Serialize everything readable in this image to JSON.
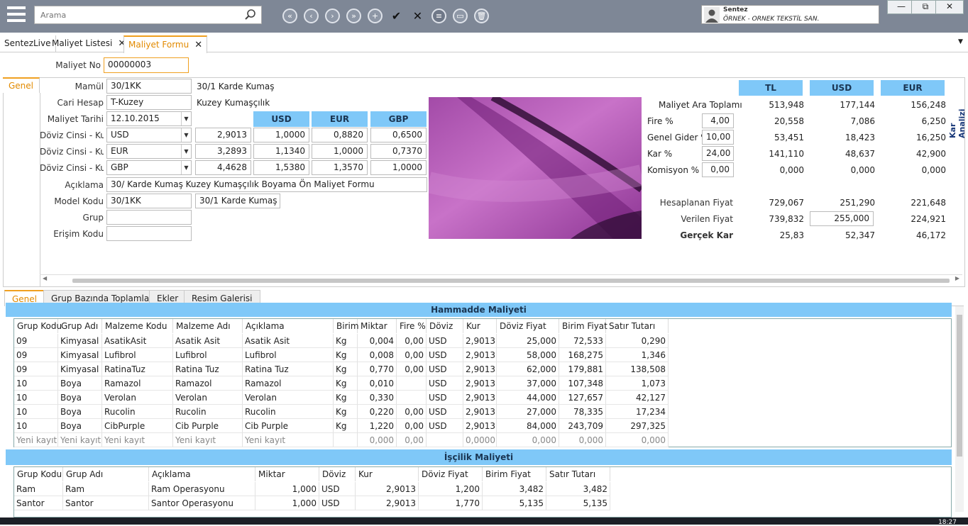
{
  "toolbar": {
    "search_placeholder": "Arama",
    "nav": [
      "«",
      "‹",
      "›",
      "»",
      "+",
      "✔",
      "✕",
      "≡",
      "▭",
      "🗑"
    ]
  },
  "user": {
    "name": "Sentez",
    "company": "ÖRNEK - ORNEK TEKSTİL SAN."
  },
  "window": {
    "minimize": "—",
    "restore": "⧉",
    "close": "✕"
  },
  "tabs": [
    {
      "label": "SentezLive"
    },
    {
      "label": "Maliyet Listesi",
      "close": "✕"
    },
    {
      "label": "Maliyet Formu",
      "close": "✕"
    }
  ],
  "tabs_menu": "▼",
  "form": {
    "maliyet_no_label": "Maliyet No",
    "maliyet_no": "00000003",
    "side_tab": "Genel",
    "mamul_label": "Mamül",
    "mamul_code": "30/1KK",
    "mamul_name": "30/1 Karde Kumaş",
    "cari_label": "Cari Hesap",
    "cari_code": "T-Kuzey",
    "cari_name": "Kuzey Kumaşçılık",
    "tarih_label": "Maliyet Tarihi",
    "tarih": "12.10.2015",
    "rate_headers": [
      "USD",
      "EUR",
      "GBP"
    ],
    "doviz_rows": [
      {
        "label": "Döviz Cinsi - Kur",
        "currency": "USD",
        "kur": "2,9013",
        "usd": "1,0000",
        "eur": "0,8820",
        "gbp": "0,6500"
      },
      {
        "label": "Döviz Cinsi - Kur",
        "currency": "EUR",
        "kur": "3,2893",
        "usd": "1,1340",
        "eur": "1,0000",
        "gbp": "0,7370"
      },
      {
        "label": "Döviz Cinsi - Kur",
        "currency": "GBP",
        "kur": "4,4628",
        "usd": "1,5380",
        "eur": "1,3570",
        "gbp": "1,0000"
      }
    ],
    "aciklama_label": "Açıklama",
    "aciklama": "30/ Karde Kumaş Kuzey Kumaşçılık Boyama Ön Maliyet Formu",
    "model_label": "Model Kodu",
    "model_code": "30/1KK",
    "model_name": "30/1 Karde Kumaş",
    "grup_label": "Grup",
    "grup": "",
    "erisim_label": "Erişim Kodu",
    "erisim": ""
  },
  "summary": {
    "headers": [
      "TL",
      "USD",
      "EUR"
    ],
    "side_label": "Kar Analizi",
    "rows": [
      {
        "label": "Maliyet Ara Toplamı",
        "input": "",
        "tl": "513,948",
        "usd": "177,144",
        "eur": "156,248"
      },
      {
        "label": "Fire %",
        "input": "4,00",
        "tl": "20,558",
        "usd": "7,086",
        "eur": "6,250"
      },
      {
        "label": "Genel Gider %",
        "input": "10,00",
        "tl": "53,451",
        "usd": "18,423",
        "eur": "16,250"
      },
      {
        "label": "Kar %",
        "input": "24,00",
        "tl": "141,110",
        "usd": "48,637",
        "eur": "42,900"
      },
      {
        "label": "Komisyon %",
        "input": "0,00",
        "tl": "0,000",
        "usd": "0,000",
        "eur": "0,000"
      }
    ],
    "hesaplanan_label": "Hesaplanan Fiyat",
    "hesaplanan": [
      "729,067",
      "251,290",
      "221,648"
    ],
    "verilen_label": "Verilen Fiyat",
    "verilen": [
      "739,832",
      "255,000",
      "224,921"
    ],
    "gercek_label": "Gerçek Kar",
    "gercek": [
      "25,83",
      "52,347",
      "46,172"
    ]
  },
  "bottom_tabs": [
    "Genel",
    "Grup Bazında Toplamlar",
    "Ekler",
    "Resim Galerisi"
  ],
  "hammadde": {
    "title": "Hammadde Maliyeti",
    "columns": [
      "Grup Kodu",
      "Grup Adı",
      "Malzeme Kodu",
      "Malzeme Adı",
      "Açıklama",
      "Birim",
      "Miktar",
      "Fire %",
      "Döviz",
      "Kur",
      "Döviz Fiyat",
      "Birim Fiyat",
      "Satır Tutarı"
    ],
    "rows": [
      [
        "09",
        "Kimyasal",
        "AsatikAsit",
        "Asatik Asit",
        "Asatik Asit",
        "Kg",
        "0,004",
        "0,00",
        "USD",
        "2,9013",
        "25,000",
        "72,533",
        "0,290"
      ],
      [
        "09",
        "Kimyasal",
        "Lufibrol",
        "Lufibrol",
        "Lufibrol",
        "Kg",
        "0,008",
        "0,00",
        "USD",
        "2,9013",
        "58,000",
        "168,275",
        "1,346"
      ],
      [
        "09",
        "Kimyasal",
        "RatinaTuz",
        "Ratina Tuz",
        "Ratina Tuz",
        "Kg",
        "0,770",
        "0,00",
        "USD",
        "2,9013",
        "62,000",
        "179,881",
        "138,508"
      ],
      [
        "10",
        "Boya",
        "Ramazol",
        "Ramazol",
        "Ramazol",
        "Kg",
        "0,010",
        "",
        "USD",
        "2,9013",
        "37,000",
        "107,348",
        "1,073"
      ],
      [
        "10",
        "Boya",
        "Verolan",
        "Verolan",
        "Verolan",
        "Kg",
        "0,330",
        "",
        "USD",
        "2,9013",
        "44,000",
        "127,657",
        "42,127"
      ],
      [
        "10",
        "Boya",
        "Rucolin",
        "Rucolin",
        "Rucolin",
        "Kg",
        "0,220",
        "0,00",
        "USD",
        "2,9013",
        "27,000",
        "78,335",
        "17,234"
      ],
      [
        "10",
        "Boya",
        "CibPurple",
        "Cib Purple",
        "Cib Purple",
        "Kg",
        "1,220",
        "0,00",
        "USD",
        "2,9013",
        "84,000",
        "243,709",
        "297,325"
      ]
    ],
    "new_row": [
      "Yeni kayıt",
      "Yeni kayıt",
      "Yeni kayıt",
      "Yeni kayıt",
      "Yeni kayıt",
      "",
      "0,000",
      "0,00",
      "",
      "0,0000",
      "0,000",
      "0,000",
      "0,000"
    ]
  },
  "iscilik": {
    "title": "İşçilik Maliyeti",
    "columns": [
      "Grup Kodu",
      "Grup Adı",
      "Açıklama",
      "Miktar",
      "Döviz",
      "Kur",
      "Döviz Fiyat",
      "Birim Fiyat",
      "Satır Tutarı"
    ],
    "rows": [
      [
        "Ram",
        "Ram",
        "Ram Operasyonu",
        "1,000",
        "USD",
        "2,9013",
        "1,200",
        "3,482",
        "3,482"
      ],
      [
        "Santor",
        "Santor",
        "Santor Operasyonu",
        "1,000",
        "USD",
        "2,9013",
        "1,770",
        "5,135",
        "5,135"
      ]
    ]
  },
  "clock": "18:27"
}
